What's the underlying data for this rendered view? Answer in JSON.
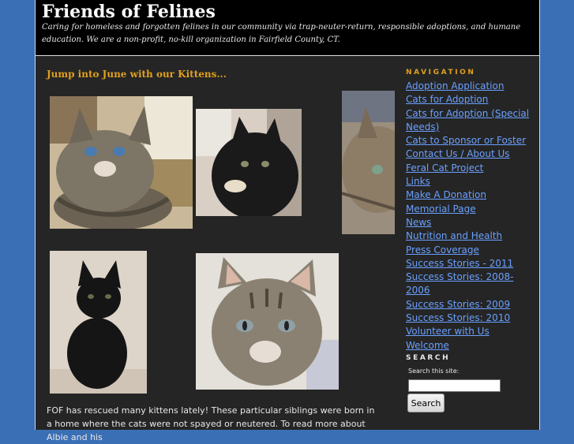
{
  "header": {
    "title": "Friends of Felines",
    "description": "Caring for homeless and forgotten felines in our community via trap-neuter-return, responsible adoptions, and humane education. We are a non-profit, no-kill organization in Fairfield County, CT."
  },
  "post": {
    "title": "Jump into June with our Kittens...",
    "body": "FOF has rescued many kittens lately! These particular siblings were born in a home where the cats were not spayed or neutered. To read more about Albie and his"
  },
  "sidebar": {
    "nav_heading": "NAVIGATION",
    "nav_items": [
      {
        "label": "Adoption Application"
      },
      {
        "label": "Cats for Adoption"
      },
      {
        "label": "Cats for Adoption (Special Needs)"
      },
      {
        "label": "Cats to Sponsor or Foster"
      },
      {
        "label": "Contact Us / About Us"
      },
      {
        "label": "Feral Cat Project"
      },
      {
        "label": "Links"
      },
      {
        "label": "Make A Donation"
      },
      {
        "label": "Memorial Page"
      },
      {
        "label": "News"
      },
      {
        "label": "Nutrition and Health"
      },
      {
        "label": "Press Coverage"
      },
      {
        "label": "Success Stories - 2011"
      },
      {
        "label": "Success Stories: 2008-2006"
      },
      {
        "label": "Success Stories: 2009"
      },
      {
        "label": "Success Stories: 2010"
      },
      {
        "label": "Volunteer with Us"
      },
      {
        "label": "Welcome"
      }
    ],
    "search_heading": "SEARCH",
    "search_label": "Search this site:",
    "search_value": "",
    "search_button": "Search"
  },
  "colors": {
    "page_background": "#3b6fb5",
    "content_background": "#252525",
    "header_background": "#000000",
    "accent": "#e0a020",
    "link": "#6aa0ff"
  }
}
